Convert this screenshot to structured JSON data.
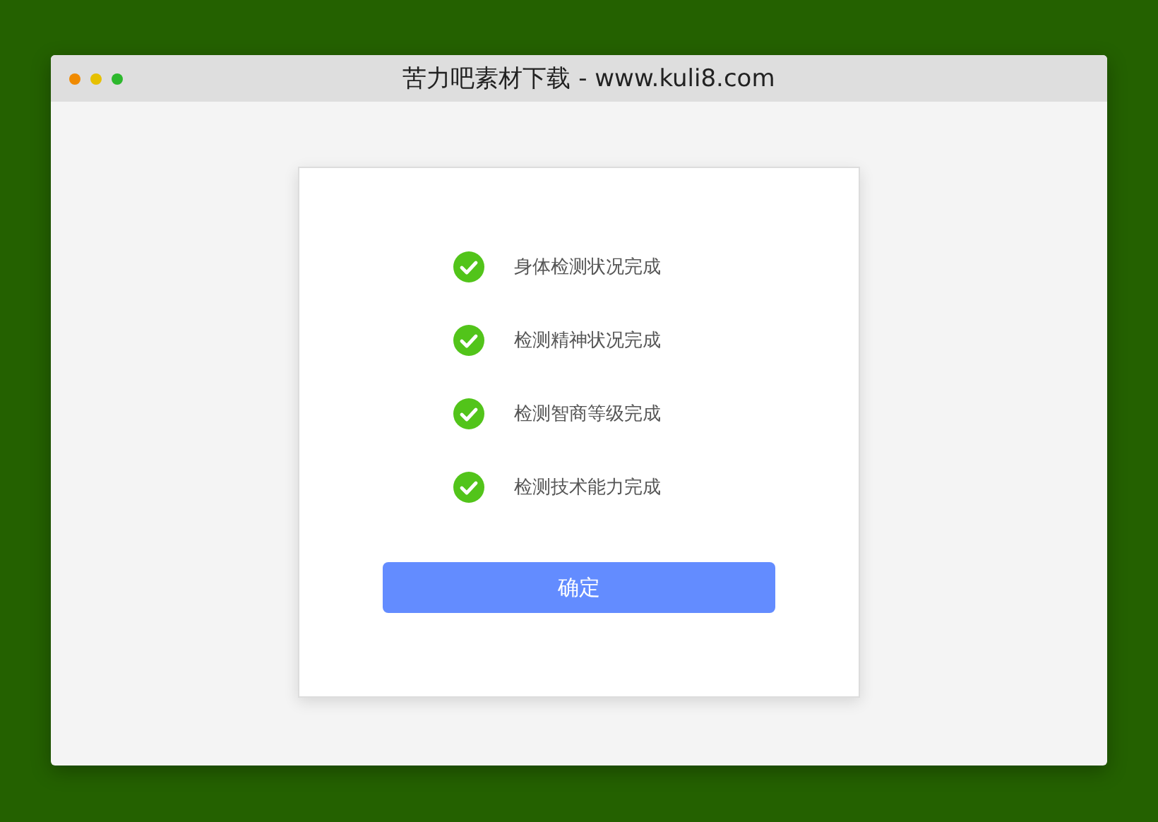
{
  "window": {
    "title": "苦力吧素材下载 - www.kuli8.com"
  },
  "checks": [
    {
      "label": "身体检测状况完成",
      "done": true
    },
    {
      "label": "检测精神状况完成",
      "done": true
    },
    {
      "label": "检测智商等级完成",
      "done": true
    },
    {
      "label": "检测技术能力完成",
      "done": true
    }
  ],
  "button": {
    "label": "确定"
  }
}
